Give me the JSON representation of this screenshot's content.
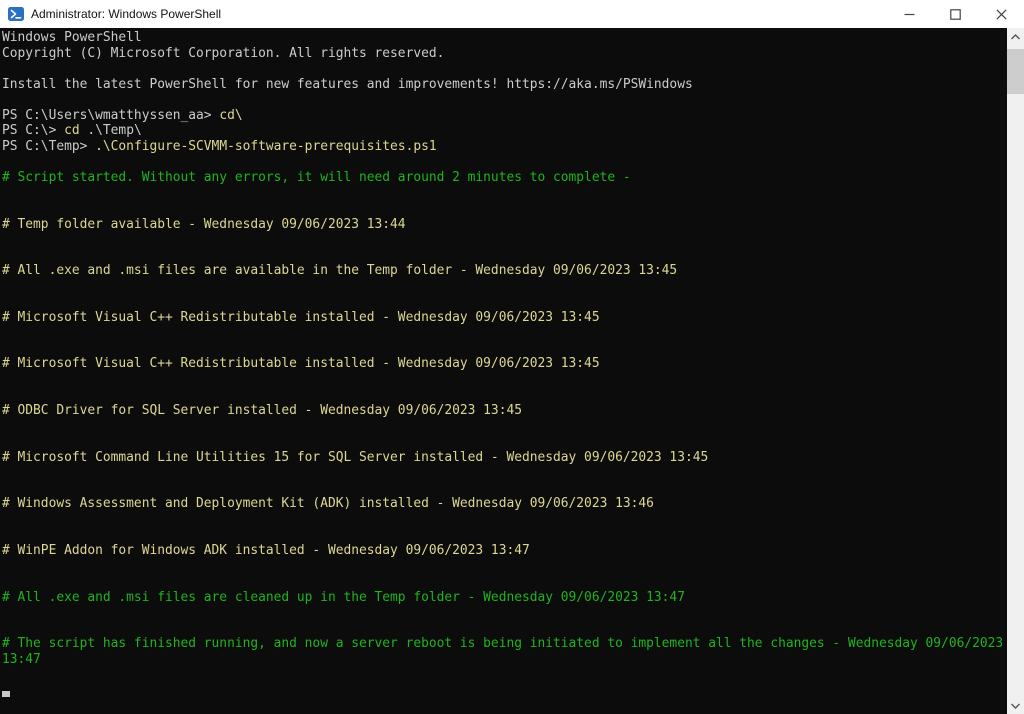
{
  "window": {
    "title": "Administrator: Windows PowerShell",
    "icons": {
      "app": "powershell-icon",
      "minimize": "minimize-icon",
      "maximize": "maximize-icon",
      "close": "close-icon",
      "scroll_up": "chevron-up-icon",
      "scroll_down": "chevron-down-icon"
    }
  },
  "colors": {
    "background": "#0c0c0c",
    "default": "#cccccc",
    "yellow": "#ddd794",
    "command": "#ddd794",
    "green": "#1fb41f",
    "titlebar": "#ffffff",
    "powershell_blue": "#2b71c2"
  },
  "terminal": {
    "lines": [
      {
        "color": "default",
        "text": "Windows PowerShell"
      },
      {
        "color": "default",
        "text": "Copyright (C) Microsoft Corporation. All rights reserved."
      },
      {
        "text": ""
      },
      {
        "color": "default",
        "text": "Install the latest PowerShell for new features and improvements! https://aka.ms/PSWindows"
      },
      {
        "text": ""
      },
      {
        "segments": [
          {
            "color": "default",
            "text": "PS C:\\Users\\wmatthyssen_aa> "
          },
          {
            "color": "command",
            "text": "cd\\"
          }
        ]
      },
      {
        "segments": [
          {
            "color": "default",
            "text": "PS C:\\> "
          },
          {
            "color": "command",
            "text": "cd"
          },
          {
            "color": "default",
            "text": " .\\Temp\\"
          }
        ]
      },
      {
        "segments": [
          {
            "color": "default",
            "text": "PS C:\\Temp> "
          },
          {
            "color": "command",
            "text": ".\\Configure-SCVMM-software-prerequisites.ps1"
          }
        ]
      },
      {
        "text": ""
      },
      {
        "color": "green",
        "text": "# Script started. Without any errors, it will need around 2 minutes to complete -"
      },
      {
        "text": ""
      },
      {
        "text": ""
      },
      {
        "color": "yellow",
        "text": "# Temp folder available - Wednesday 09/06/2023 13:44"
      },
      {
        "text": ""
      },
      {
        "text": ""
      },
      {
        "color": "yellow",
        "text": "# All .exe and .msi files are available in the Temp folder - Wednesday 09/06/2023 13:45"
      },
      {
        "text": ""
      },
      {
        "text": ""
      },
      {
        "color": "yellow",
        "text": "# Microsoft Visual C++ Redistributable installed - Wednesday 09/06/2023 13:45"
      },
      {
        "text": ""
      },
      {
        "text": ""
      },
      {
        "color": "yellow",
        "text": "# Microsoft Visual C++ Redistributable installed - Wednesday 09/06/2023 13:45"
      },
      {
        "text": ""
      },
      {
        "text": ""
      },
      {
        "color": "yellow",
        "text": "# ODBC Driver for SQL Server installed - Wednesday 09/06/2023 13:45"
      },
      {
        "text": ""
      },
      {
        "text": ""
      },
      {
        "color": "yellow",
        "text": "# Microsoft Command Line Utilities 15 for SQL Server installed - Wednesday 09/06/2023 13:45"
      },
      {
        "text": ""
      },
      {
        "text": ""
      },
      {
        "color": "yellow",
        "text": "# Windows Assessment and Deployment Kit (ADK) installed - Wednesday 09/06/2023 13:46"
      },
      {
        "text": ""
      },
      {
        "text": ""
      },
      {
        "color": "yellow",
        "text": "# WinPE Addon for Windows ADK installed - Wednesday 09/06/2023 13:47"
      },
      {
        "text": ""
      },
      {
        "text": ""
      },
      {
        "color": "green",
        "text": "# All .exe and .msi files are cleaned up in the Temp folder - Wednesday 09/06/2023 13:47"
      },
      {
        "text": ""
      },
      {
        "text": ""
      },
      {
        "color": "green",
        "text": "# The script has finished running, and now a server reboot is being initiated to implement all the changes - Wednesday 09/06/2023"
      },
      {
        "color": "green",
        "text": "13:47"
      },
      {
        "text": ""
      },
      {
        "cursor": true
      }
    ]
  }
}
